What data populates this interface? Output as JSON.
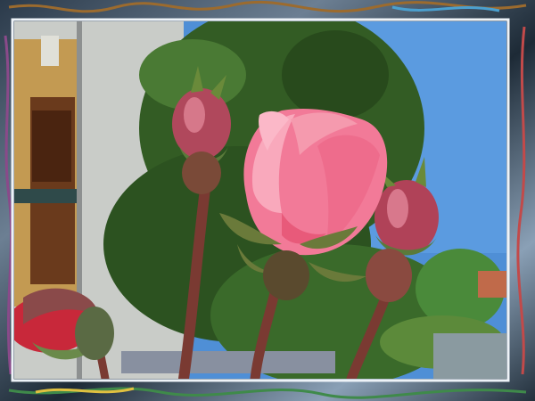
{
  "image": {
    "subject": "pink-rose-with-buds",
    "frame_style": "psychedelic-marbled-border",
    "colors": {
      "sky": "#4f8fd6",
      "petal": "#f27a98",
      "petal_light": "#f9a9bc",
      "bud": "#b0485c",
      "stem": "#7a3a32",
      "leaf": "#3c6a2a",
      "wall": "#c9ccc8",
      "frame_dark": "#0e1a22",
      "frame_accent": "#d8e1ea"
    }
  }
}
